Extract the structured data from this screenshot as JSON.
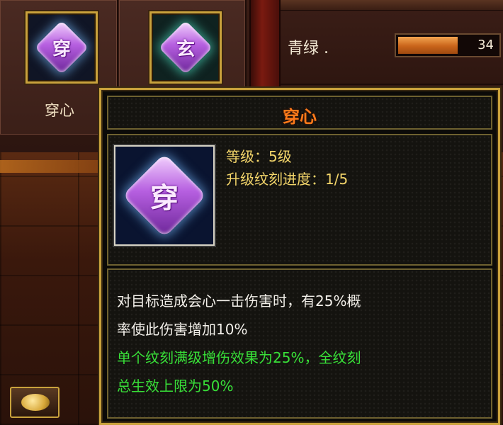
{
  "slots": [
    {
      "glyph": "穿",
      "label": "穿心"
    },
    {
      "glyph": "玄",
      "label": ""
    }
  ],
  "stat": {
    "label": "青绿 .",
    "value": "34",
    "fill_fraction": 0.6
  },
  "tooltip": {
    "title": "穿心",
    "icon_glyph": "穿",
    "level": "等级：5级",
    "progress": "升级纹刻进度：1/5",
    "desc_line1": "对目标造成会心一击伤害时，有25%概",
    "desc_line2": "率使此伤害增加10%",
    "bonus_line1": "单个纹刻满级增伤效果为25%，全纹刻",
    "bonus_line2": "总生效上限为50%"
  },
  "icons": [
    "skill-chuanxin-icon",
    "skill-xuan-icon",
    "coins-icon"
  ],
  "colors": {
    "title": "#ff7a1a",
    "info": "#f3d56a",
    "desc": "#f3f0ea",
    "bonus": "#38e038",
    "border": "#c9a23c"
  }
}
